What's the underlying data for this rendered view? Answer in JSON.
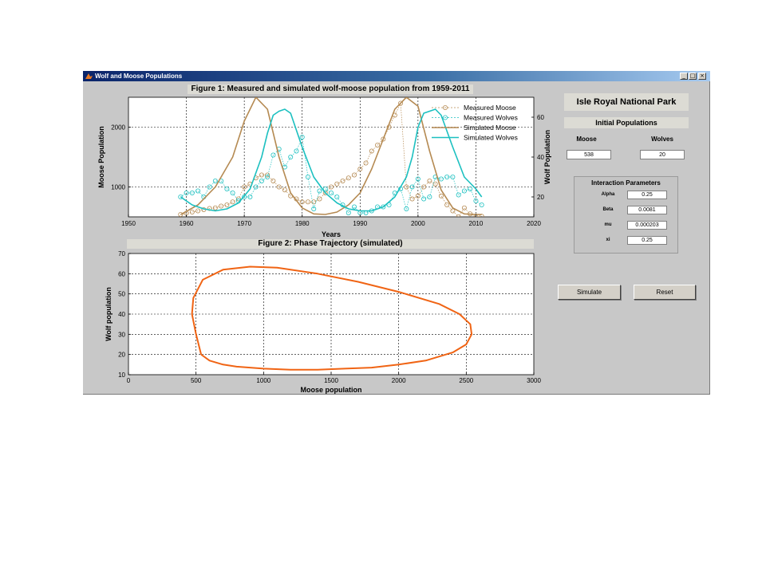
{
  "window": {
    "title": "Wolf and Moose Populations",
    "min_glyph": "_",
    "max_glyph": "□",
    "close_glyph": "×"
  },
  "figure1": {
    "title": "Figure 1: Measured and simulated wolf-moose population from 1959-2011",
    "xlabel": "Years",
    "ylabel_left": "Moose Population",
    "ylabel_right": "Wolf Population",
    "legend": [
      "Measured Moose",
      "Measured Wolves",
      "Simulated Moose",
      "Simulated Wolves"
    ]
  },
  "figure2": {
    "title": "Figure 2: Phase Trajectory (simulated)",
    "xlabel": "Moose population",
    "ylabel": "Wolf population"
  },
  "panel": {
    "park_title": "Isle Royal National Park",
    "initial_title": "Initial Populations",
    "moose_label": "Moose",
    "wolves_label": "Wolves",
    "moose_value": "538",
    "wolves_value": "20",
    "interaction_title": "Interaction Parameters",
    "params": [
      {
        "label": "Alpha",
        "value": "0.25"
      },
      {
        "label": "Beta",
        "value": "0.0081"
      },
      {
        "label": "mu",
        "value": "0.000203"
      },
      {
        "label": "xi",
        "value": "0.25"
      }
    ],
    "simulate_label": "Simulate",
    "reset_label": "Reset"
  },
  "colors": {
    "moose": "#b58a52",
    "wolves": "#1cc0c0",
    "phase": "#f06414",
    "titlebar": "#0a246a"
  },
  "chart_data": [
    {
      "type": "line",
      "title": "Figure 1: Measured and simulated wolf-moose population from 1959-2011",
      "xlabel": "Years",
      "ylabel": "Moose Population",
      "y2label": "Wolf Population",
      "xlim": [
        1950,
        2020
      ],
      "ylim": [
        500,
        2500
      ],
      "y2lim": [
        10,
        70
      ],
      "xticks": [
        1950,
        1960,
        1970,
        1980,
        1990,
        2000,
        2010,
        2020
      ],
      "yticks": [
        1000,
        2000
      ],
      "y2ticks": [
        20,
        40,
        60
      ],
      "grid": true,
      "legend_position": "top-right",
      "series": [
        {
          "name": "Measured Moose",
          "axis": "left",
          "style": "dashed-circle",
          "x": [
            1959,
            1960,
            1961,
            1962,
            1963,
            1964,
            1965,
            1966,
            1967,
            1968,
            1969,
            1970,
            1971,
            1972,
            1973,
            1974,
            1975,
            1976,
            1977,
            1978,
            1979,
            1980,
            1981,
            1982,
            1983,
            1984,
            1985,
            1986,
            1987,
            1988,
            1989,
            1990,
            1991,
            1992,
            1993,
            1994,
            1995,
            1996,
            1997,
            1998,
            1999,
            2000,
            2001,
            2002,
            2003,
            2004,
            2005,
            2006,
            2007,
            2008,
            2009,
            2010,
            2011
          ],
          "y": [
            540,
            560,
            580,
            600,
            620,
            640,
            650,
            680,
            700,
            750,
            800,
            1000,
            1050,
            1150,
            1200,
            1200,
            1100,
            1000,
            950,
            850,
            800,
            750,
            750,
            750,
            800,
            900,
            1000,
            1050,
            1100,
            1150,
            1200,
            1300,
            1400,
            1600,
            1700,
            1800,
            2000,
            2200,
            2400,
            1000,
            800,
            850,
            1000,
            1100,
            1050,
            850,
            700,
            600,
            500,
            650,
            550,
            500,
            510
          ]
        },
        {
          "name": "Measured Wolves",
          "axis": "right",
          "style": "dashed-circle",
          "x": [
            1959,
            1960,
            1961,
            1962,
            1963,
            1964,
            1965,
            1966,
            1967,
            1968,
            1969,
            1970,
            1971,
            1972,
            1973,
            1974,
            1975,
            1976,
            1977,
            1978,
            1979,
            1980,
            1981,
            1982,
            1983,
            1984,
            1985,
            1986,
            1987,
            1988,
            1989,
            1990,
            1991,
            1992,
            1993,
            1994,
            1995,
            1996,
            1997,
            1998,
            1999,
            2000,
            2001,
            2002,
            2003,
            2004,
            2005,
            2006,
            2007,
            2008,
            2009,
            2010,
            2011
          ],
          "y": [
            20,
            22,
            22,
            23,
            20,
            25,
            28,
            28,
            24,
            22,
            18,
            20,
            20,
            25,
            28,
            30,
            41,
            44,
            35,
            40,
            43,
            50,
            30,
            14,
            23,
            24,
            22,
            20,
            16,
            12,
            15,
            12,
            12,
            13,
            15,
            15,
            16,
            22,
            24,
            14,
            25,
            29,
            19,
            20,
            30,
            29,
            30,
            30,
            21,
            23,
            24,
            18,
            16
          ]
        },
        {
          "name": "Simulated Moose",
          "axis": "left",
          "style": "solid",
          "x": [
            1959,
            1962,
            1965,
            1968,
            1970,
            1972,
            1974,
            1976,
            1978,
            1980,
            1982,
            1984,
            1986,
            1988,
            1990,
            1992,
            1994,
            1996,
            1998,
            2000,
            2002,
            2004,
            2006,
            2008,
            2010,
            2011
          ],
          "y": [
            538,
            700,
            1000,
            1500,
            2100,
            2500,
            2300,
            1500,
            900,
            650,
            550,
            540,
            580,
            700,
            900,
            1300,
            1800,
            2300,
            2500,
            2350,
            1600,
            950,
            650,
            550,
            540,
            538
          ]
        },
        {
          "name": "Simulated Wolves",
          "axis": "right",
          "style": "solid",
          "x": [
            1959,
            1961,
            1963,
            1965,
            1967,
            1969,
            1971,
            1973,
            1974,
            1975,
            1976,
            1977,
            1978,
            1980,
            1982,
            1984,
            1986,
            1988,
            1990,
            1992,
            1994,
            1996,
            1998,
            1999,
            2000,
            2001,
            2002,
            2003,
            2004,
            2006,
            2008,
            2010,
            2011
          ],
          "y": [
            20,
            16,
            14,
            13,
            14,
            17,
            24,
            40,
            52,
            61,
            63,
            64,
            62,
            45,
            30,
            22,
            17,
            14,
            13,
            13,
            15,
            20,
            30,
            40,
            55,
            62,
            63,
            64,
            61,
            45,
            30,
            24,
            20
          ]
        }
      ]
    },
    {
      "type": "line",
      "title": "Figure 2: Phase Trajectory (simulated)",
      "xlabel": "Moose population",
      "ylabel": "Wolf population",
      "xlim": [
        0,
        3000
      ],
      "ylim": [
        10,
        70
      ],
      "xticks": [
        0,
        500,
        1000,
        1500,
        2000,
        2500,
        3000
      ],
      "yticks": [
        10,
        20,
        30,
        40,
        50,
        60,
        70
      ],
      "grid": true,
      "series": [
        {
          "name": "",
          "x": [
            538,
            600,
            700,
            800,
            1000,
            1200,
            1400,
            1600,
            1800,
            2000,
            2200,
            2400,
            2500,
            2540,
            2530,
            2450,
            2300,
            2000,
            1700,
            1400,
            1100,
            900,
            700,
            550,
            480,
            470,
            500,
            538
          ],
          "y": [
            20,
            17,
            15,
            14,
            13,
            12.5,
            12.5,
            13,
            13.5,
            15,
            17,
            21,
            25,
            30,
            35,
            40,
            45,
            51,
            56,
            60,
            63,
            63.5,
            62,
            57,
            48,
            40,
            30,
            20
          ]
        }
      ]
    }
  ]
}
